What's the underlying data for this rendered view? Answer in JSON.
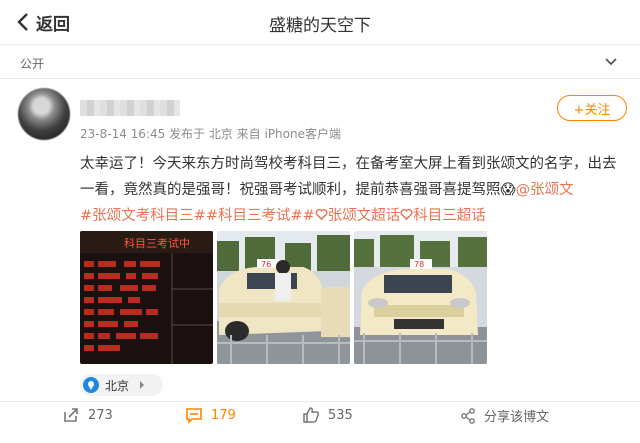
{
  "header": {
    "back_label": "返回",
    "title": "盛糖的天空下"
  },
  "visibility": {
    "label": "公开"
  },
  "post": {
    "meta": "23-8-14 16:45 发布于 北京 来自 iPhone客户端",
    "follow_label": "+关注",
    "text_main": "太幸运了！今天来东方时尚驾校考科目三，在备考室大屏上看到张颂文的名字，出去一看，竟然真的是强哥！祝强哥考试顺利，提前恭喜强哥喜提驾照😱",
    "mention": "@张颂文",
    "topics": [
      "#张颂文考科目三#",
      "#科目三考试#",
      "张颂文超话",
      "科目三超话"
    ],
    "images": [
      {
        "screen_text": "科目三考试中"
      },
      {
        "plate": "76"
      },
      {
        "plate": "78"
      }
    ],
    "location": "北京",
    "actions": {
      "repost": "273",
      "comments": "179",
      "likes": "535",
      "share": "分享该博文"
    }
  },
  "colors": {
    "accent": "#ff8200",
    "link": "#eb7350",
    "location_pin": "#1e88e5"
  }
}
